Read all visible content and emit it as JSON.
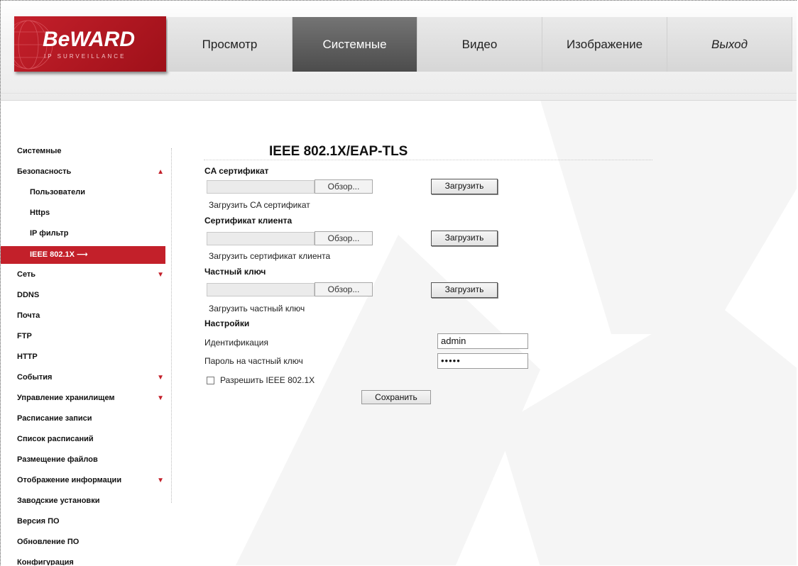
{
  "brand": {
    "logo_text": "BeWARD",
    "logo_subtext": "IP SURVEILLANCE"
  },
  "nav": {
    "items": [
      {
        "label": "Просмотр",
        "active": false
      },
      {
        "label": "Системные",
        "active": true
      },
      {
        "label": "Видео",
        "active": false
      },
      {
        "label": "Изображение",
        "active": false
      },
      {
        "label": "Выход",
        "active": false
      }
    ]
  },
  "sidebar": {
    "items": [
      {
        "label": "Системные"
      },
      {
        "label": "Безопасность",
        "arrow": "▲"
      },
      {
        "label": "Пользователи"
      },
      {
        "label": "Https"
      },
      {
        "label": "IP фильтр"
      },
      {
        "label": "IEEE 802.1X ⟶"
      },
      {
        "label": "Сеть",
        "arrow": "▼"
      },
      {
        "label": "DDNS"
      },
      {
        "label": "Почта"
      },
      {
        "label": "FTP"
      },
      {
        "label": "HTTP"
      },
      {
        "label": "События",
        "arrow": "▼"
      },
      {
        "label": "Управление хранилищем",
        "arrow": "▼"
      },
      {
        "label": "Расписание записи"
      },
      {
        "label": "Список расписаний"
      },
      {
        "label": "Размещение файлов"
      },
      {
        "label": "Отображение информации",
        "arrow": "▼"
      },
      {
        "label": "Заводские установки"
      },
      {
        "label": "Версия ПО"
      },
      {
        "label": "Обновление ПО"
      },
      {
        "label": "Конфигурация"
      }
    ]
  },
  "main": {
    "title": "IEEE 802.1X/EAP-TLS",
    "ca": {
      "label": "CA сертификат",
      "browse": "Обзор...",
      "upload": "Загрузить",
      "hint": "Загрузить CA сертификат"
    },
    "client": {
      "label": "Сертификат клиента",
      "browse": "Обзор...",
      "upload": "Загрузить",
      "hint": "Загрузить сертификат клиента"
    },
    "key": {
      "label": "Частный ключ",
      "browse": "Обзор...",
      "upload": "Загрузить",
      "hint": "Загрузить частный ключ"
    },
    "settings": {
      "label": "Настройки",
      "identity_label": "Идентификация",
      "identity_value": "admin",
      "password_label": "Пароль на частный ключ",
      "password_value": "•••••",
      "enable_label": "Разрешить IEEE 802.1X",
      "enable_checked": false,
      "save": "Сохранить"
    }
  },
  "colors": {
    "accent": "#c3202a",
    "nav_active": "#5a5a5a",
    "watermark": "#f4f4f4"
  }
}
